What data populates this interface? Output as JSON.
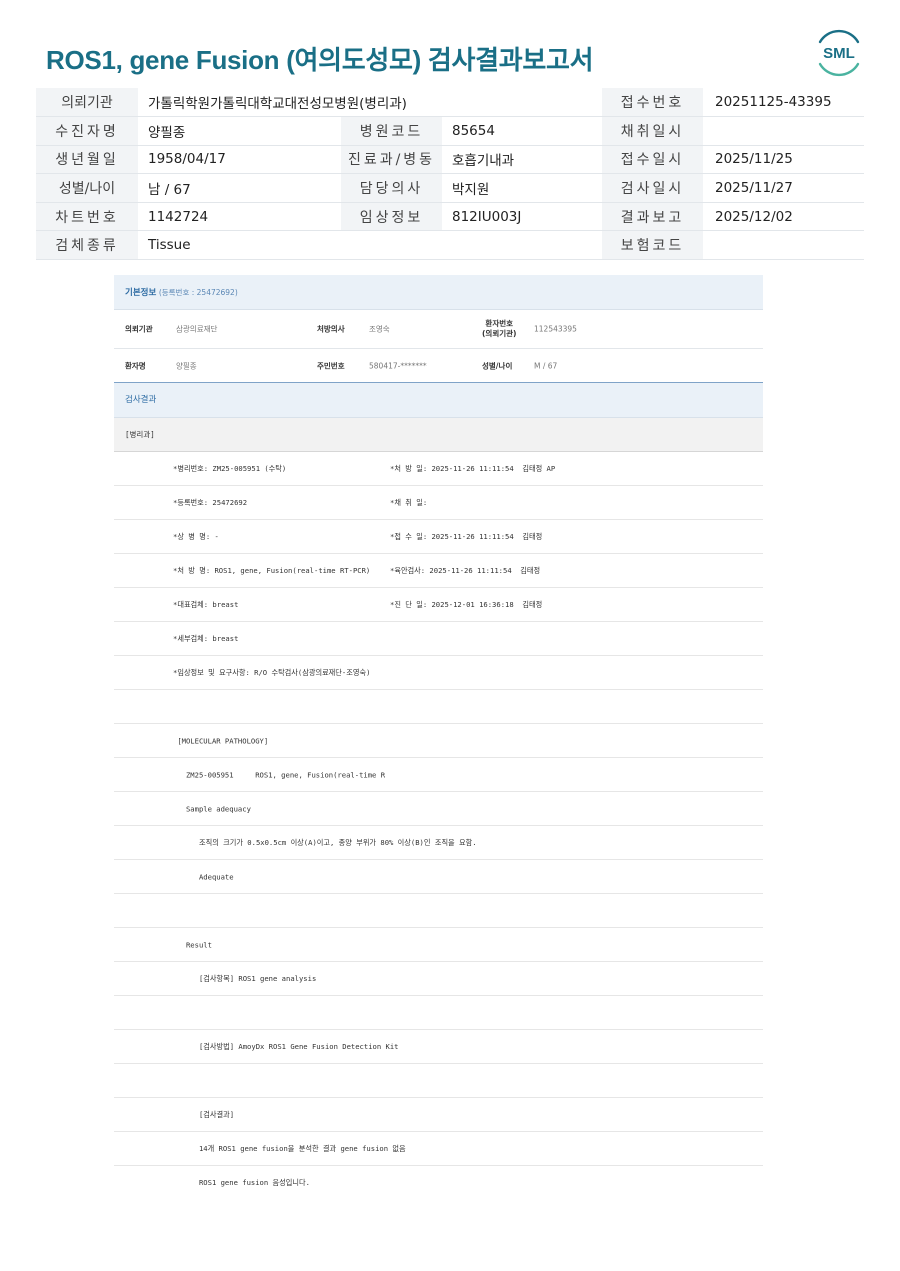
{
  "title": "ROS1, gene Fusion (여의도성모) 검사결과보고서",
  "logo_text": "SML",
  "info": {
    "rows": [
      {
        "l1": "의뢰기관",
        "v1": "가톨릭학원가톨릭대학교대전성모병원(병리과)",
        "l2": "",
        "v2": "",
        "l3": "접수번호",
        "v3": "20251125-43395"
      },
      {
        "l1": "수진자명",
        "v1": "양필종",
        "l2": "병원코드",
        "v2": "85654",
        "l3": "채취일시",
        "v3": ""
      },
      {
        "l1": "생년월일",
        "v1": "1958/04/17",
        "l2": "진료과/병동",
        "v2": "호흡기내과",
        "l3": "접수일시",
        "v3": "2025/11/25"
      },
      {
        "l1": "성별/나이",
        "v1": "남 / 67",
        "l2": "담당의사",
        "v2": "박지원",
        "l3": "검사일시",
        "v3": "2025/11/27"
      },
      {
        "l1": "차트번호",
        "v1": "1142724",
        "l2": "임상정보",
        "v2": "812IU003J",
        "l3": "결과보고",
        "v3": "2025/12/02"
      },
      {
        "l1": "검체종류",
        "v1": "Tissue",
        "l2": "",
        "v2": "",
        "l3": "보험코드",
        "v3": ""
      }
    ]
  },
  "report": {
    "basic_title": "기본정보",
    "basic_sub": "(등록번호 : 25472692)",
    "p1": {
      "l1": "의뢰기관",
      "v1": "삼광의료재단",
      "l2": "처방의사",
      "v2": "조영숙",
      "l3": "환자번호\n(의뢰기관)",
      "v3": "112543395"
    },
    "p2": {
      "l1": "환자명",
      "v1": "양필종",
      "l2": "주민번호",
      "v2": "580417-*******",
      "l3": "성별/나이",
      "v3": "M / 67"
    },
    "result_title": "검사결과",
    "section": "[병리과]",
    "lines": [
      {
        "a": "*병리번호: ZM25-005951 (수탁)",
        "b": "*처 방 일: 2025-11-26 11:11:54  김태정 AP"
      },
      {
        "a": "*등록번호: 25472692",
        "b": "*채 취 일:"
      },
      {
        "a": "*상 병 명: -",
        "b": "*접 수 일: 2025-11-26 11:11:54  김태정"
      },
      {
        "a": "*처 방 명: ROS1, gene, Fusion(real-time RT-PCR)",
        "b": "*육안검사: 2025-11-26 11:11:54  김태정"
      },
      {
        "a": "*대표검체: breast",
        "b": "*진 단 일: 2025-12-01 16:36:18  김태정"
      },
      {
        "a": "*세부검체: breast",
        "b": ""
      },
      {
        "a": "*임상정보 및 요구사항: R/O 수탁검사(삼광의료재단-조영숙)",
        "b": ""
      },
      {
        "a": "",
        "b": ""
      },
      {
        "a": " [MOLECULAR PATHOLOGY]",
        "b": ""
      },
      {
        "a": "   ZM25-005951     ROS1, gene, Fusion(real-time R",
        "b": ""
      },
      {
        "a": "   Sample adequacy",
        "b": ""
      },
      {
        "a": "      조직의 크기가 0.5x0.5cm 이상(A)이고, 종양 부위가 80% 이상(B)인 조직을 요함.",
        "b": ""
      },
      {
        "a": "      Adequate",
        "b": ""
      },
      {
        "a": "",
        "b": ""
      },
      {
        "a": "   Result",
        "b": ""
      },
      {
        "a": "      [검사항목] ROS1 gene analysis",
        "b": ""
      },
      {
        "a": "",
        "b": ""
      },
      {
        "a": "      [검사방법] AmoyDx ROS1 Gene Fusion Detection Kit",
        "b": ""
      },
      {
        "a": "",
        "b": ""
      },
      {
        "a": "      [검사결과]",
        "b": ""
      },
      {
        "a": "      14개 ROS1 gene fusion을 분석한 결과 gene fusion 없음",
        "b": ""
      },
      {
        "a": "      ROS1 gene fusion 음성입니다.",
        "b": ""
      }
    ]
  },
  "colors": {
    "title": "#1a6f86",
    "accent": "#2f6da4"
  }
}
